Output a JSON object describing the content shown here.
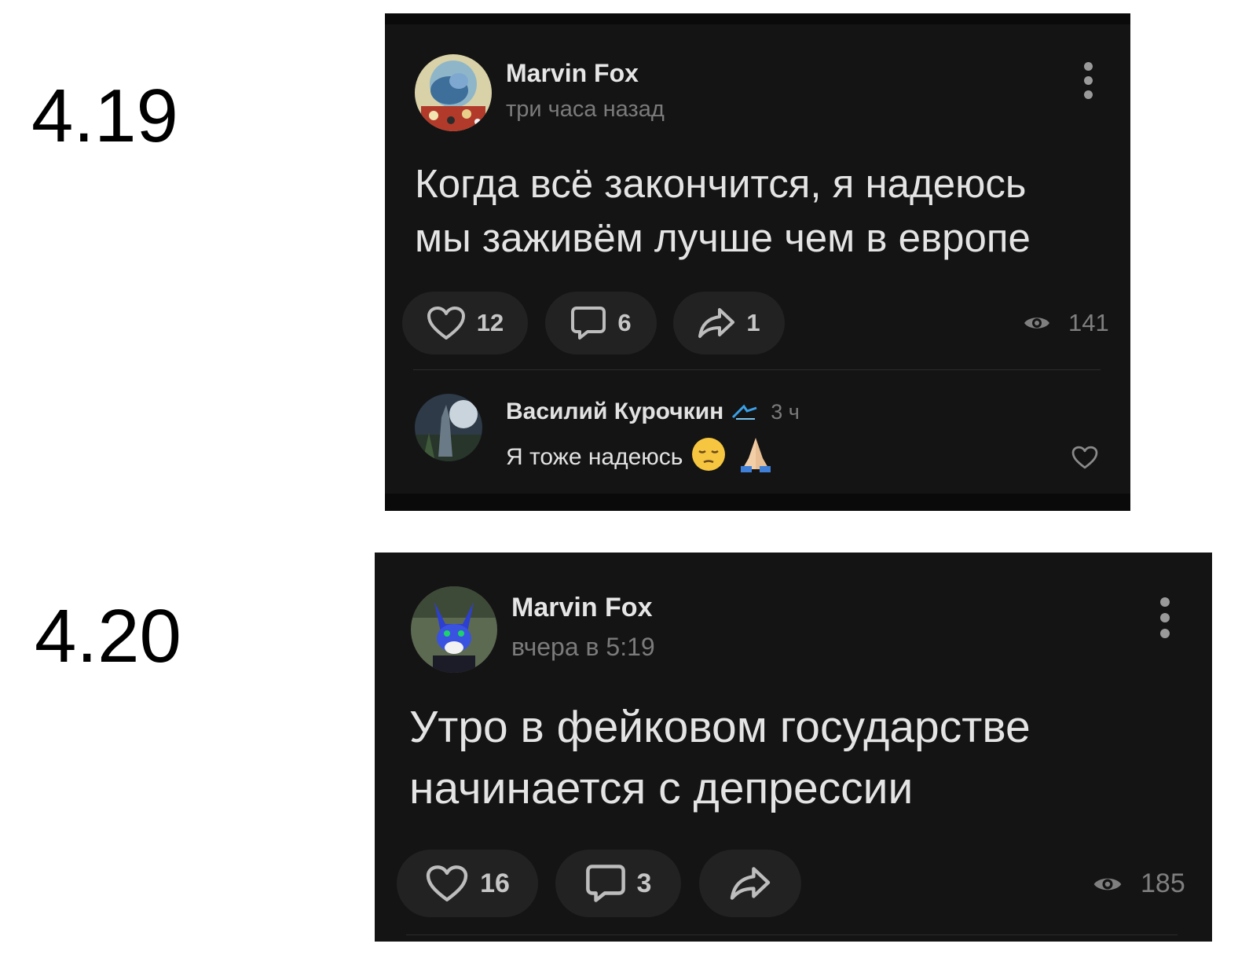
{
  "labels": {
    "first": "4.19",
    "second": "4.20"
  },
  "post1": {
    "author": "Marvin Fox",
    "time": "три часа назад",
    "text": "Когда всё закончится, я надеюсь\nмы заживём лучше чем в европе",
    "likes": "12",
    "comments": "6",
    "shares": "1",
    "views": "141",
    "comment": {
      "author": "Василий Курочкин",
      "time": "3 ч",
      "text": "Я тоже надеюсь"
    }
  },
  "post2": {
    "author": "Marvin Fox",
    "time": "вчера в 5:19",
    "text": "Утро в фейковом государстве\nначинается с депрессии",
    "likes": "16",
    "comments": "3",
    "views": "185"
  },
  "colors": {
    "card_bg": "#141414",
    "pill_bg": "#222222",
    "muted": "#7b7b7b"
  },
  "icons": [
    "heart-icon",
    "comment-icon",
    "share-icon",
    "eye-icon",
    "more-vertical-icon",
    "pensive-face-emoji",
    "folded-hands-emoji",
    "zenit-badge-icon"
  ]
}
